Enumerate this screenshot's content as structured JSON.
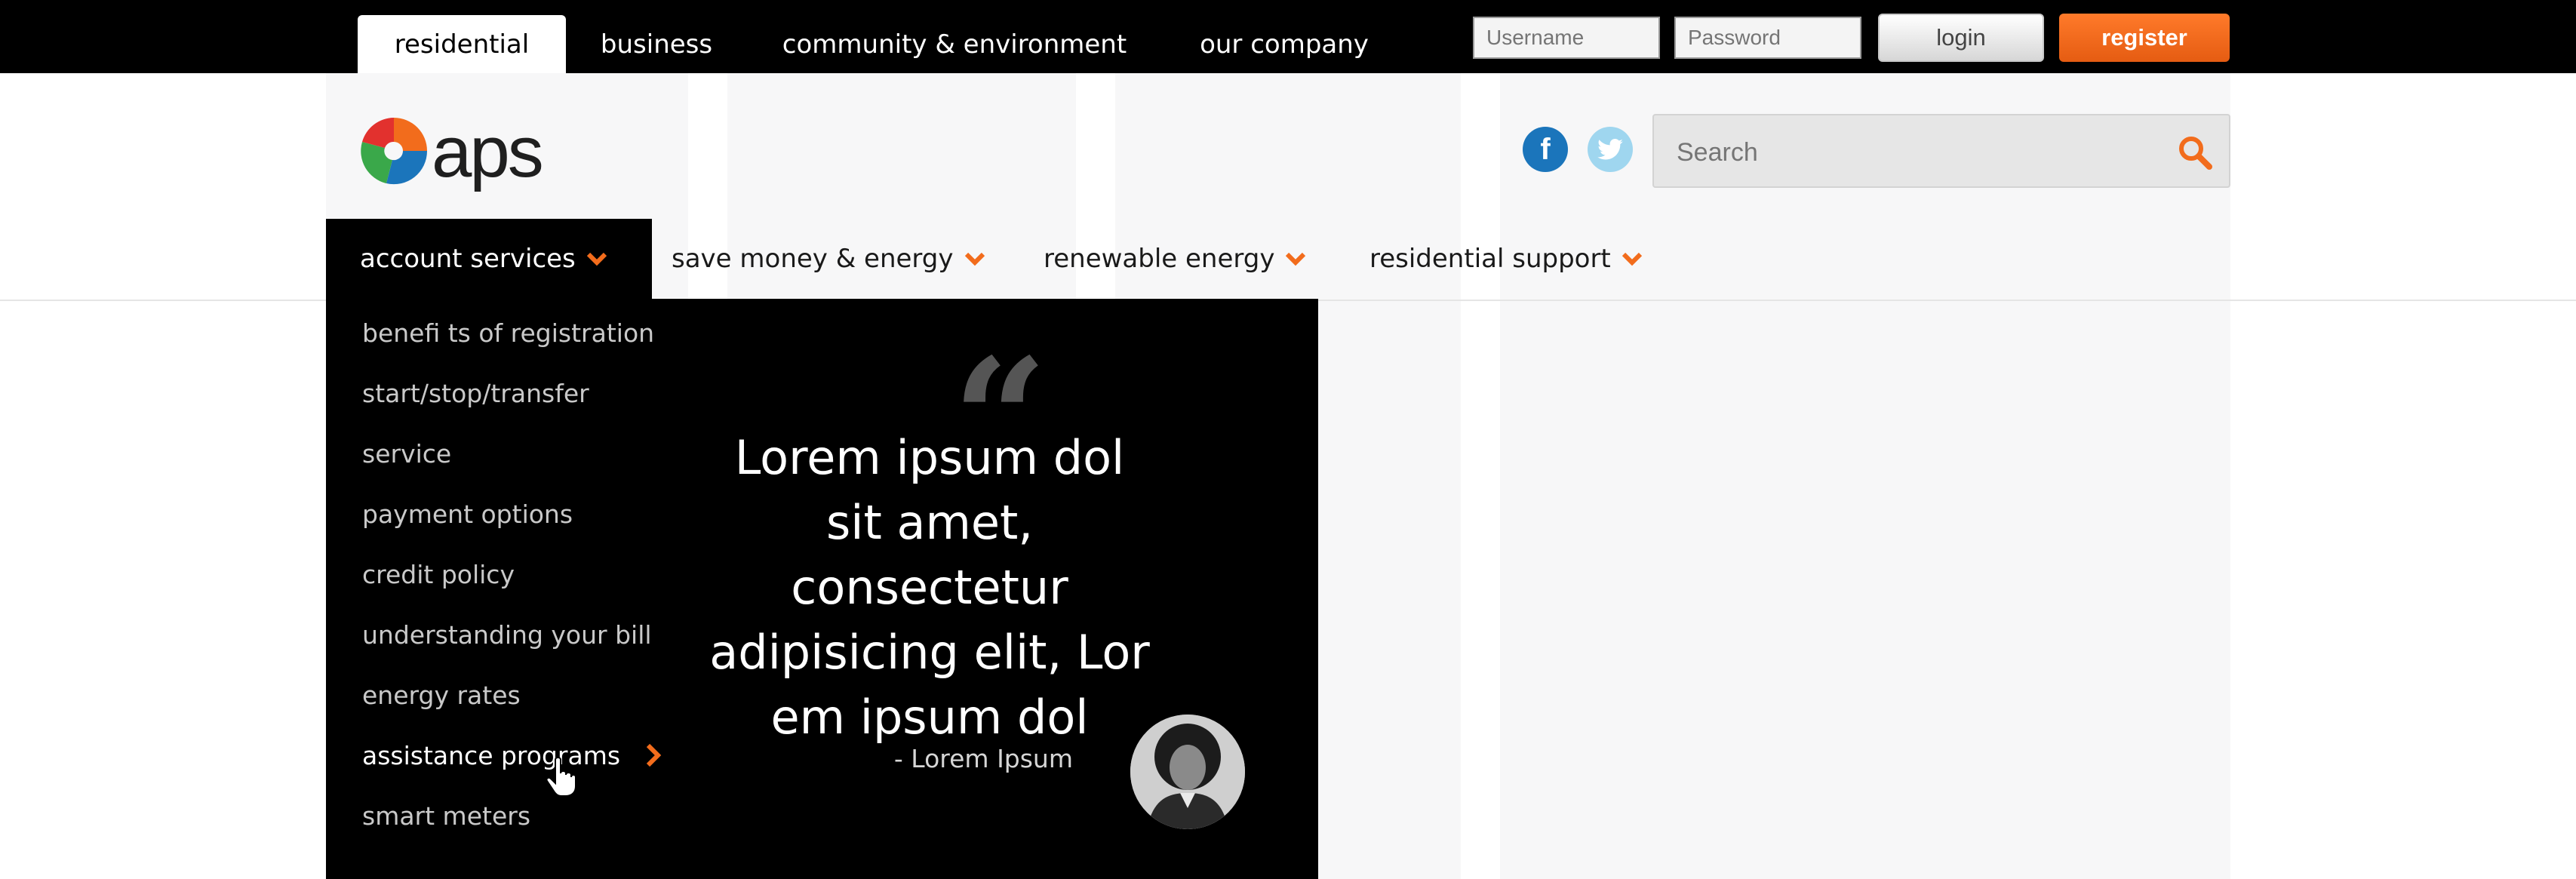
{
  "top_nav": {
    "tabs": [
      {
        "label": "residential",
        "active": true
      },
      {
        "label": "business"
      },
      {
        "label": "community & environment"
      },
      {
        "label": "our company"
      }
    ]
  },
  "auth": {
    "username_placeholder": "Username",
    "password_placeholder": "Password",
    "login_label": "login",
    "register_label": "register"
  },
  "brand": {
    "logo_text": "aps"
  },
  "social": {
    "facebook_glyph": "f"
  },
  "search": {
    "placeholder": "Search"
  },
  "main_nav": {
    "items": [
      {
        "label": "account services",
        "active": true
      },
      {
        "label": "save money & energy"
      },
      {
        "label": "renewable energy"
      },
      {
        "label": "residential support"
      }
    ]
  },
  "dropdown": {
    "links": [
      "benefi ts of registration",
      "start/stop/transfer",
      "service",
      "payment options",
      "credit policy",
      "understanding your bill",
      "energy rates",
      "assistance programs",
      "smart meters"
    ],
    "current_index": 7,
    "quote": {
      "mark": "“",
      "lines": [
        "Lorem ipsum dol",
        "sit amet, consectetur",
        "adipisicing elit, Lor",
        "em ipsum dol"
      ],
      "author": "- Lorem Ipsum"
    }
  },
  "colors": {
    "accent": "#f26c1c",
    "topbar": "#000000",
    "facebook": "#1b75bb",
    "twitter": "#9fd6ef"
  }
}
